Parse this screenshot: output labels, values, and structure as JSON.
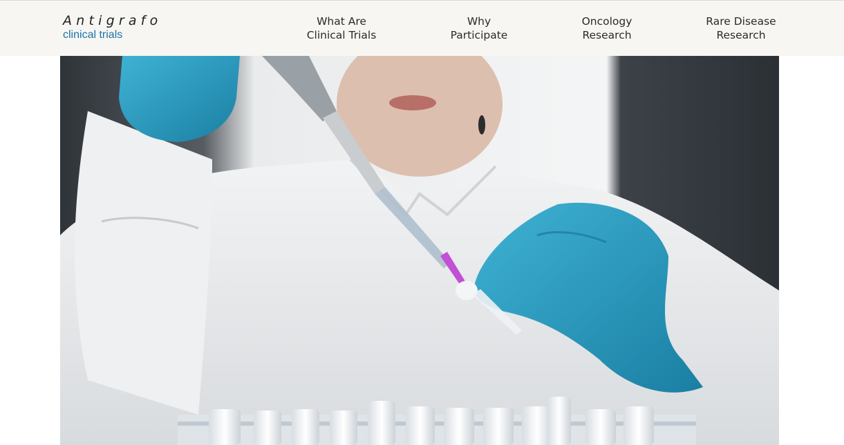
{
  "brand": {
    "name": "Antigrafo",
    "tagline": "clinical trials"
  },
  "nav": {
    "items": [
      {
        "label": "What Are\nClinical Trials"
      },
      {
        "label": "Why\nParticipate"
      },
      {
        "label": "Oncology\nResearch"
      },
      {
        "label": "Rare Disease\nResearch"
      }
    ]
  },
  "hero": {
    "subject": "lab-researcher-pipetting-sample",
    "glove_color": "#2a9bbf",
    "coat_color": "#eceeef"
  },
  "colors": {
    "header_bg": "#f7f6f3",
    "brand_accent": "#1b74a6",
    "text": "#2a2a2a"
  }
}
